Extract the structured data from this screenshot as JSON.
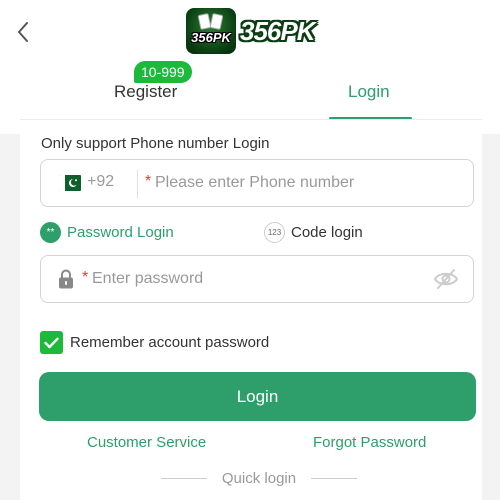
{
  "header": {
    "logo_mini": "356PK",
    "logo_text": "356PK"
  },
  "tabs": {
    "register": "Register",
    "login": "Login",
    "badge": "10-999"
  },
  "hint": "Only support Phone number Login",
  "phone": {
    "country_code": "+92",
    "required_mark": "*",
    "placeholder": "Please enter Phone number"
  },
  "modes": {
    "password_icon_text": "**",
    "password_label": "Password Login",
    "code_icon_text": "123",
    "code_label": "Code login"
  },
  "password": {
    "required_mark": "*",
    "placeholder": "Enter password"
  },
  "remember": {
    "label": "Remember account password",
    "checked": true
  },
  "login_button": "Login",
  "links": {
    "customer_service": "Customer Service",
    "forgot_password": "Forgot Password"
  },
  "quick_login": "Quick login",
  "colors": {
    "accent": "#2e9e6b",
    "badge": "#1db93b",
    "required": "#e53935"
  }
}
